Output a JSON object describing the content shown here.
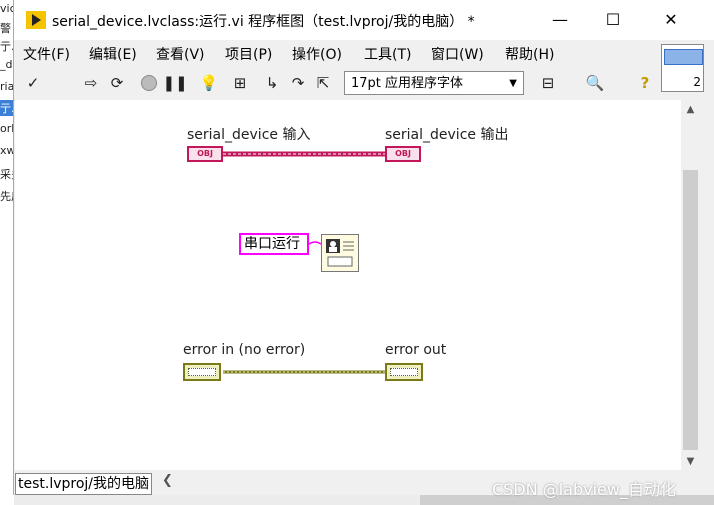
{
  "window": {
    "title": "serial_device.lvclass:运行.vi 程序框图（test.lvproj/我的电脑） *",
    "minimize": "—",
    "maximize": "☐",
    "close": "✕"
  },
  "menu": [
    "文件(F)",
    "编辑(E)",
    "查看(V)",
    "项目(P)",
    "操作(O)",
    "工具(T)",
    "窗口(W)",
    "帮助(H)"
  ],
  "toolbar": {
    "font": "17pt 应用程序字体",
    "icons": [
      "run-arrow",
      "run-continuously",
      "abort",
      "pause",
      "highlight-execution",
      "retain-wire-values",
      "step-into",
      "step-over",
      "step-out",
      "align",
      "search",
      "help"
    ]
  },
  "context_help": {
    "number": "2"
  },
  "diagram": {
    "serial_in_label": "serial_device 输入",
    "serial_out_label": "serial_device 输出",
    "obj_tag": "OBJ",
    "string_constant": "串口运行",
    "error_in_label": "error in (no error)",
    "error_out_label": "error out"
  },
  "status": {
    "project": "test.lvproj/我的电脑"
  },
  "background_text": [
    "vic",
    "警",
    "亍.",
    "_d",
    "ria",
    "亍.",
    "ork",
    "xw",
    "采多",
    "先后"
  ],
  "watermark": "CSDN @labview_自动化",
  "colors": {
    "class_wire": "#c2185b",
    "string_wire": "#ff00ff",
    "error_wire": "#7a7a1a"
  }
}
